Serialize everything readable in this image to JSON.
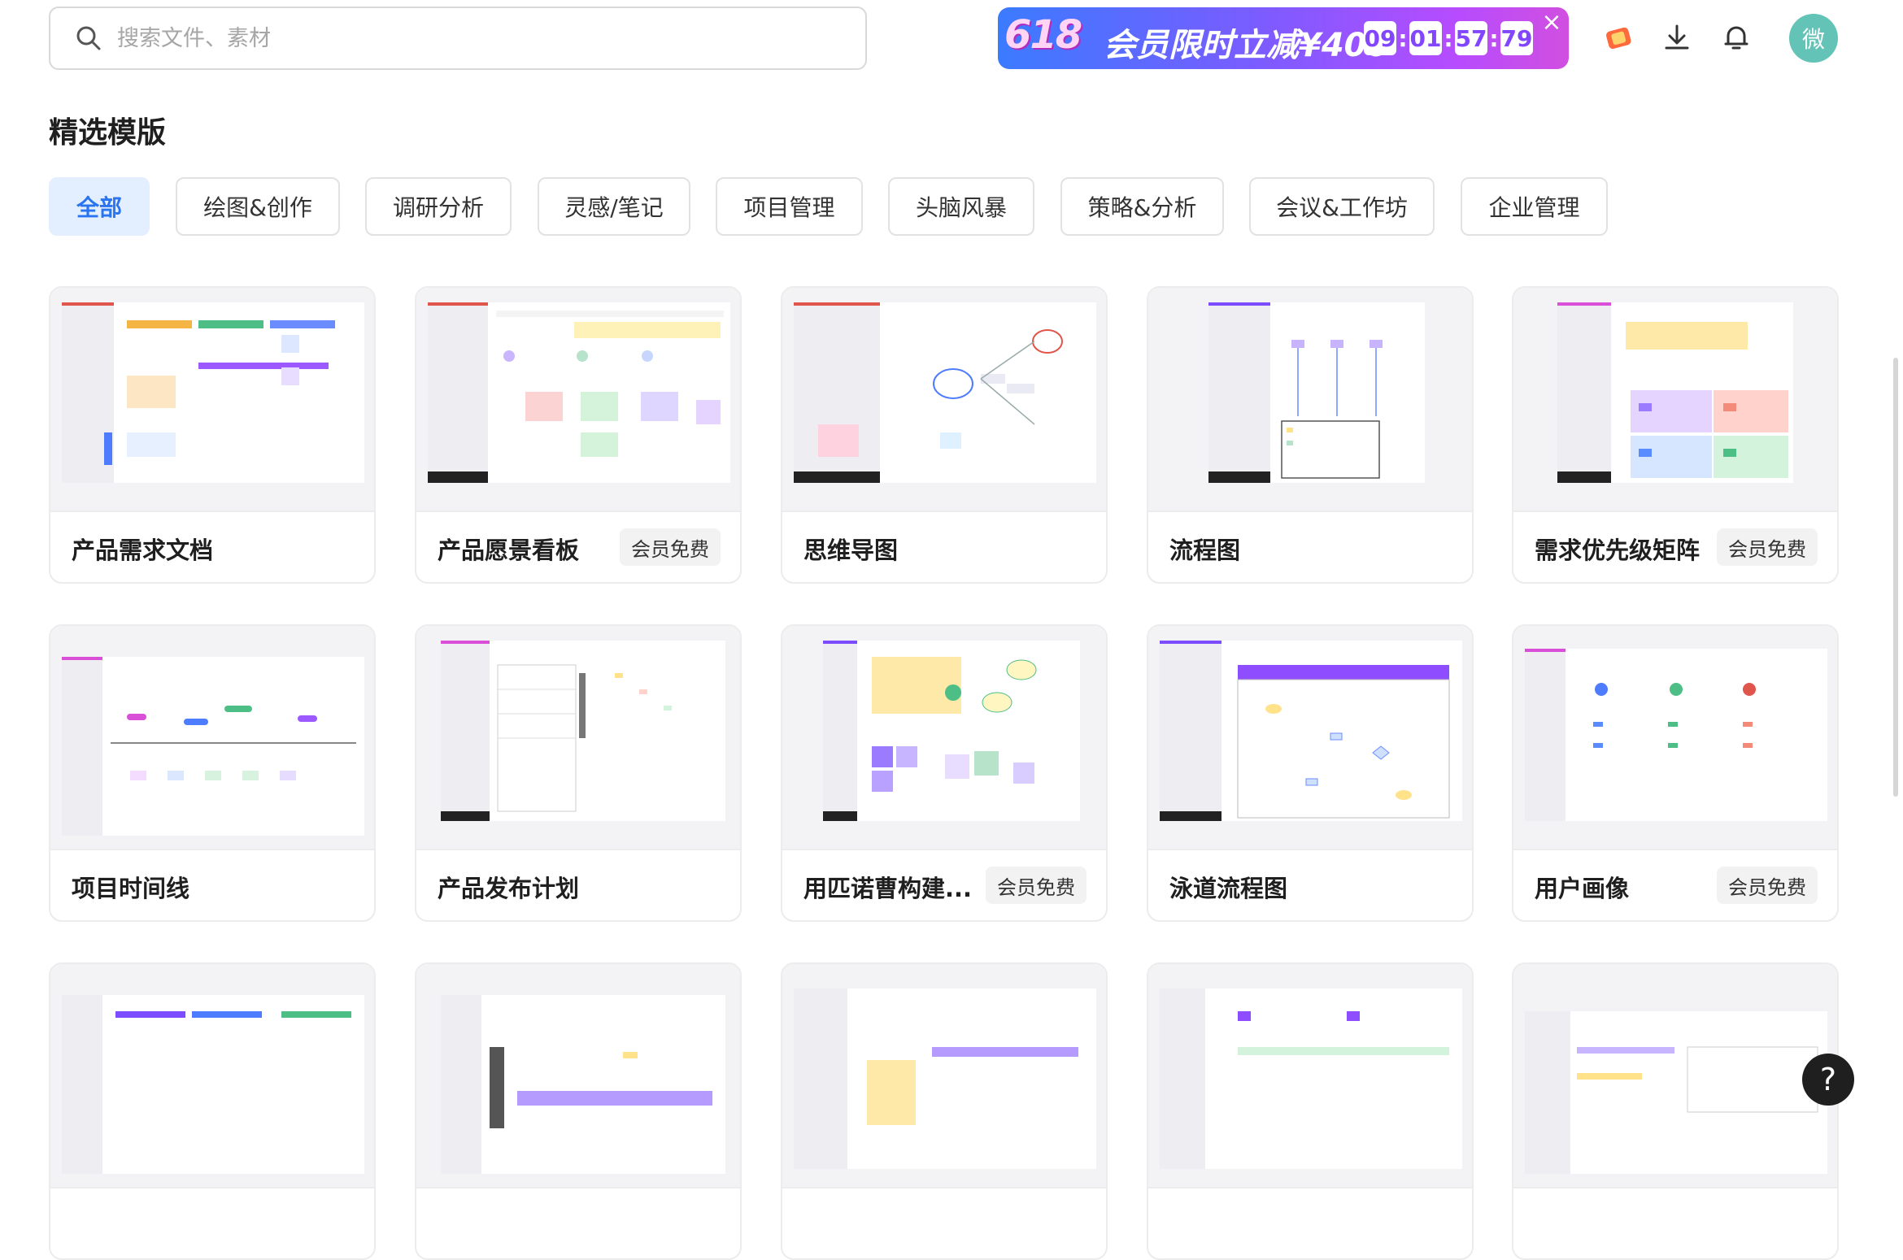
{
  "search": {
    "placeholder": "搜索文件、素材",
    "icon": "search-icon"
  },
  "promo": {
    "tag": "618",
    "text": "会员限时立减¥400",
    "timer": [
      "09",
      "01",
      "57",
      "79"
    ]
  },
  "header_icons": [
    "gift-icon",
    "download-icon",
    "bell-icon"
  ],
  "avatar": {
    "initial": "微",
    "color": "#62c3b6"
  },
  "section": {
    "title": "精选模版"
  },
  "tabs": [
    "全部",
    "绘图&创作",
    "调研分析",
    "灵感/笔记",
    "项目管理",
    "头脑风暴",
    "策略&分析",
    "会议&工作坊",
    "企业管理"
  ],
  "active_tab": "全部",
  "templates": [
    {
      "name": "产品需求文档",
      "badge": ""
    },
    {
      "name": "产品愿景看板",
      "badge": "会员免费"
    },
    {
      "name": "思维导图",
      "badge": ""
    },
    {
      "name": "流程图",
      "badge": ""
    },
    {
      "name": "需求优先级矩阵",
      "badge": "会员免费"
    },
    {
      "name": "项目时间线",
      "badge": ""
    },
    {
      "name": "产品发布计划",
      "badge": ""
    },
    {
      "name": "用匹诺曹构建...",
      "badge": "会员免费"
    },
    {
      "name": "泳道流程图",
      "badge": ""
    },
    {
      "name": "用户画像",
      "badge": "会员免费"
    }
  ],
  "help": {
    "label": "?"
  },
  "colors": {
    "accent": "#2a74f0",
    "active_tab_bg": "#e3efff"
  }
}
